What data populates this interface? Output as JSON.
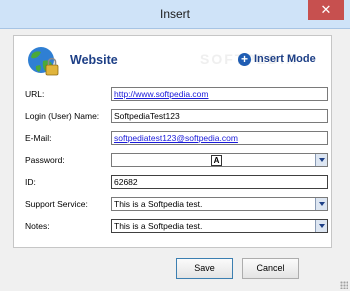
{
  "window": {
    "title": "Insert",
    "close_glyph": "✕"
  },
  "header": {
    "title": "Website",
    "mode_label": "Insert Mode",
    "watermark": "SOFTPEDIA",
    "icon": "globe-lock-icon"
  },
  "form": {
    "url": {
      "label": "URL:",
      "value": "http://www.softpedia.com"
    },
    "login": {
      "label": "Login (User) Name:",
      "value": "SoftpediaTest123"
    },
    "email": {
      "label": "E-Mail:",
      "value": "softpediatest123@softpedia.com"
    },
    "password": {
      "label": "Password:",
      "glyph": "A"
    },
    "id": {
      "label": "ID:",
      "value": "62682"
    },
    "support": {
      "label": "Support Service:",
      "value": "This is a Softpedia test."
    },
    "notes": {
      "label": "Notes:",
      "value": "This is a Softpedia test."
    }
  },
  "buttons": {
    "save": "Save",
    "cancel": "Cancel"
  },
  "colors": {
    "title_blue": "#1d3f86",
    "link_blue": "#1a1ad9"
  }
}
